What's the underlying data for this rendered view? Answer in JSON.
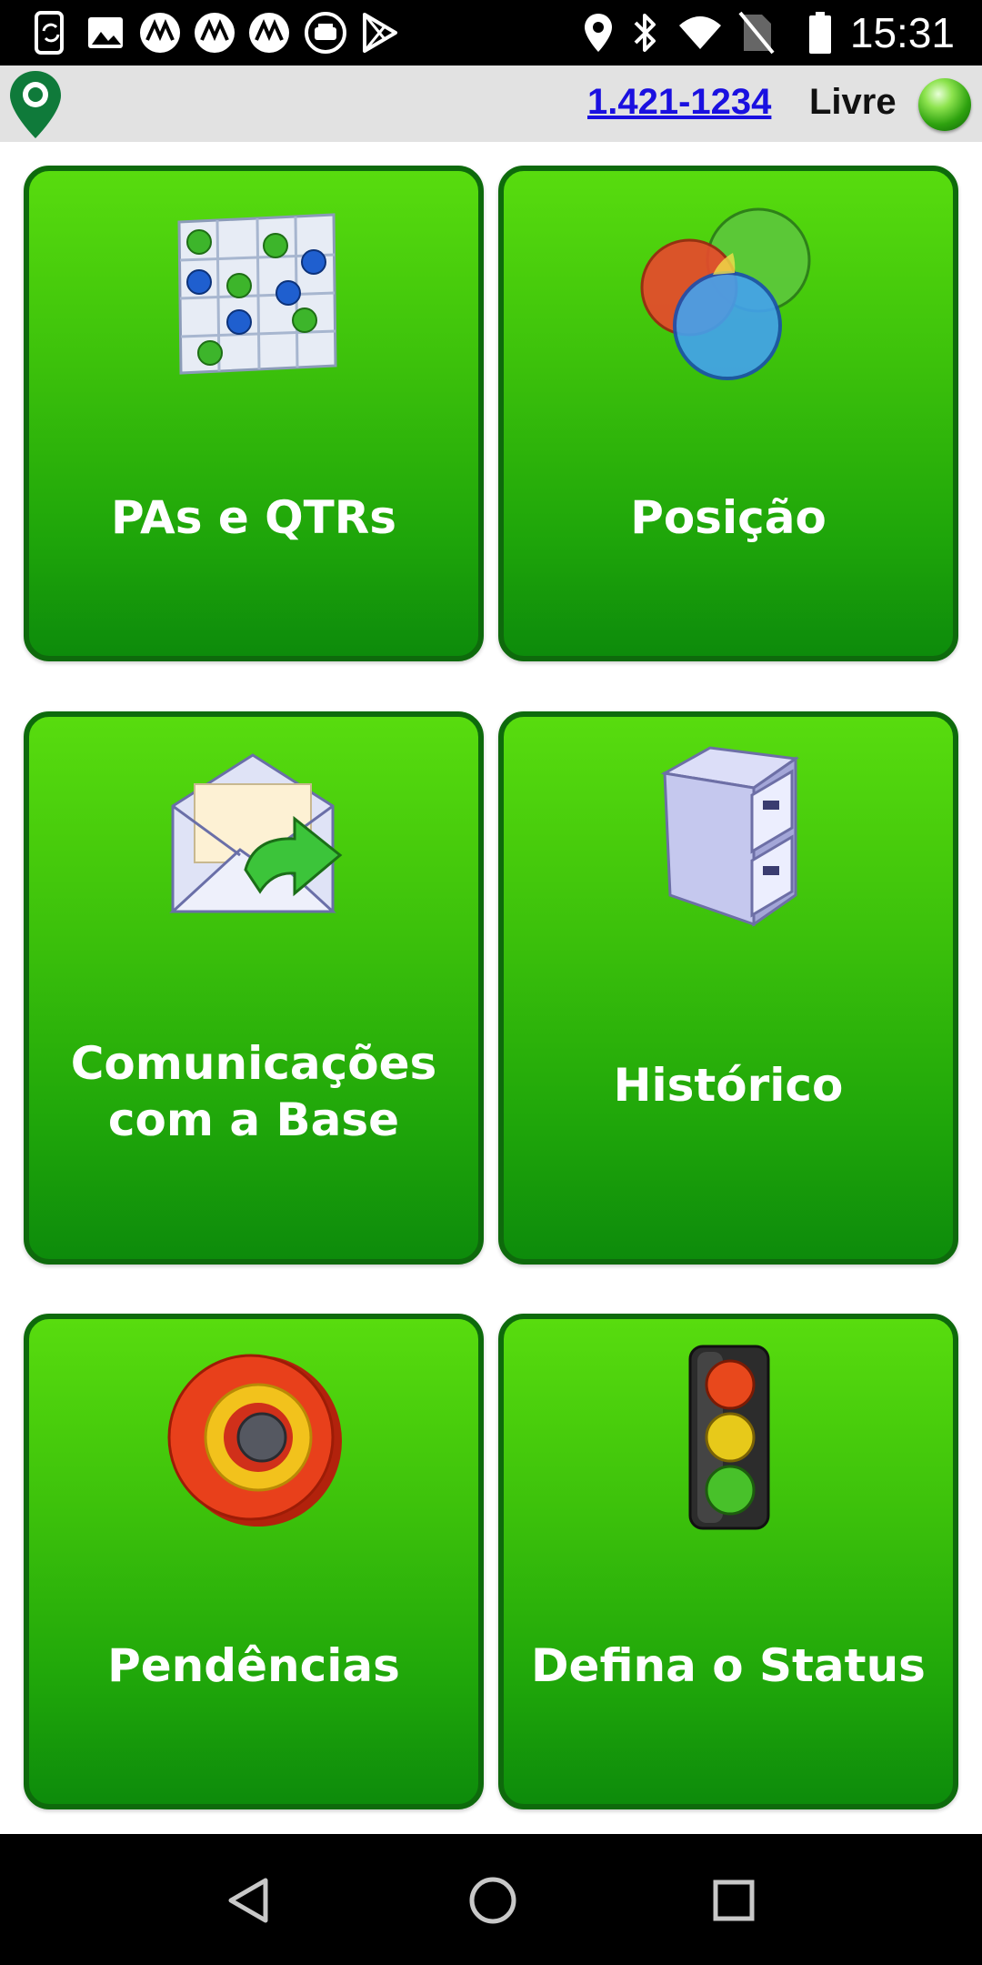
{
  "status_bar": {
    "time": "15:31",
    "left_icons": [
      "screen-sync-icon",
      "image-icon",
      "motorola-icon",
      "motorola-icon",
      "motorola-icon",
      "taxi-icon",
      "play-store-icon"
    ],
    "right_icons": [
      "location-icon",
      "bluetooth-icon",
      "wifi-icon",
      "no-sim-icon",
      "battery-icon"
    ]
  },
  "header": {
    "phone": "1.421-1234",
    "status": "Livre",
    "status_color": "#2ea20f"
  },
  "tiles": [
    {
      "label": "PAs e QTRs",
      "icon": "grid-dots-icon"
    },
    {
      "label": "Posição",
      "icon": "venn-circles-icon"
    },
    {
      "label": "Comunicações\ncom a Base",
      "icon": "envelope-forward-icon"
    },
    {
      "label": "Histórico",
      "icon": "file-cabinet-icon"
    },
    {
      "label": "Pendências",
      "icon": "target-icon"
    },
    {
      "label": "Defina o Status",
      "icon": "traffic-light-icon"
    }
  ],
  "colors": {
    "tile_border": "#0e6a0c",
    "tile_top": "#58dc0e",
    "tile_bottom": "#0d8b0b",
    "link": "#1a10e0"
  },
  "nav": {
    "buttons": [
      "back-icon",
      "home-icon",
      "recents-icon"
    ]
  }
}
